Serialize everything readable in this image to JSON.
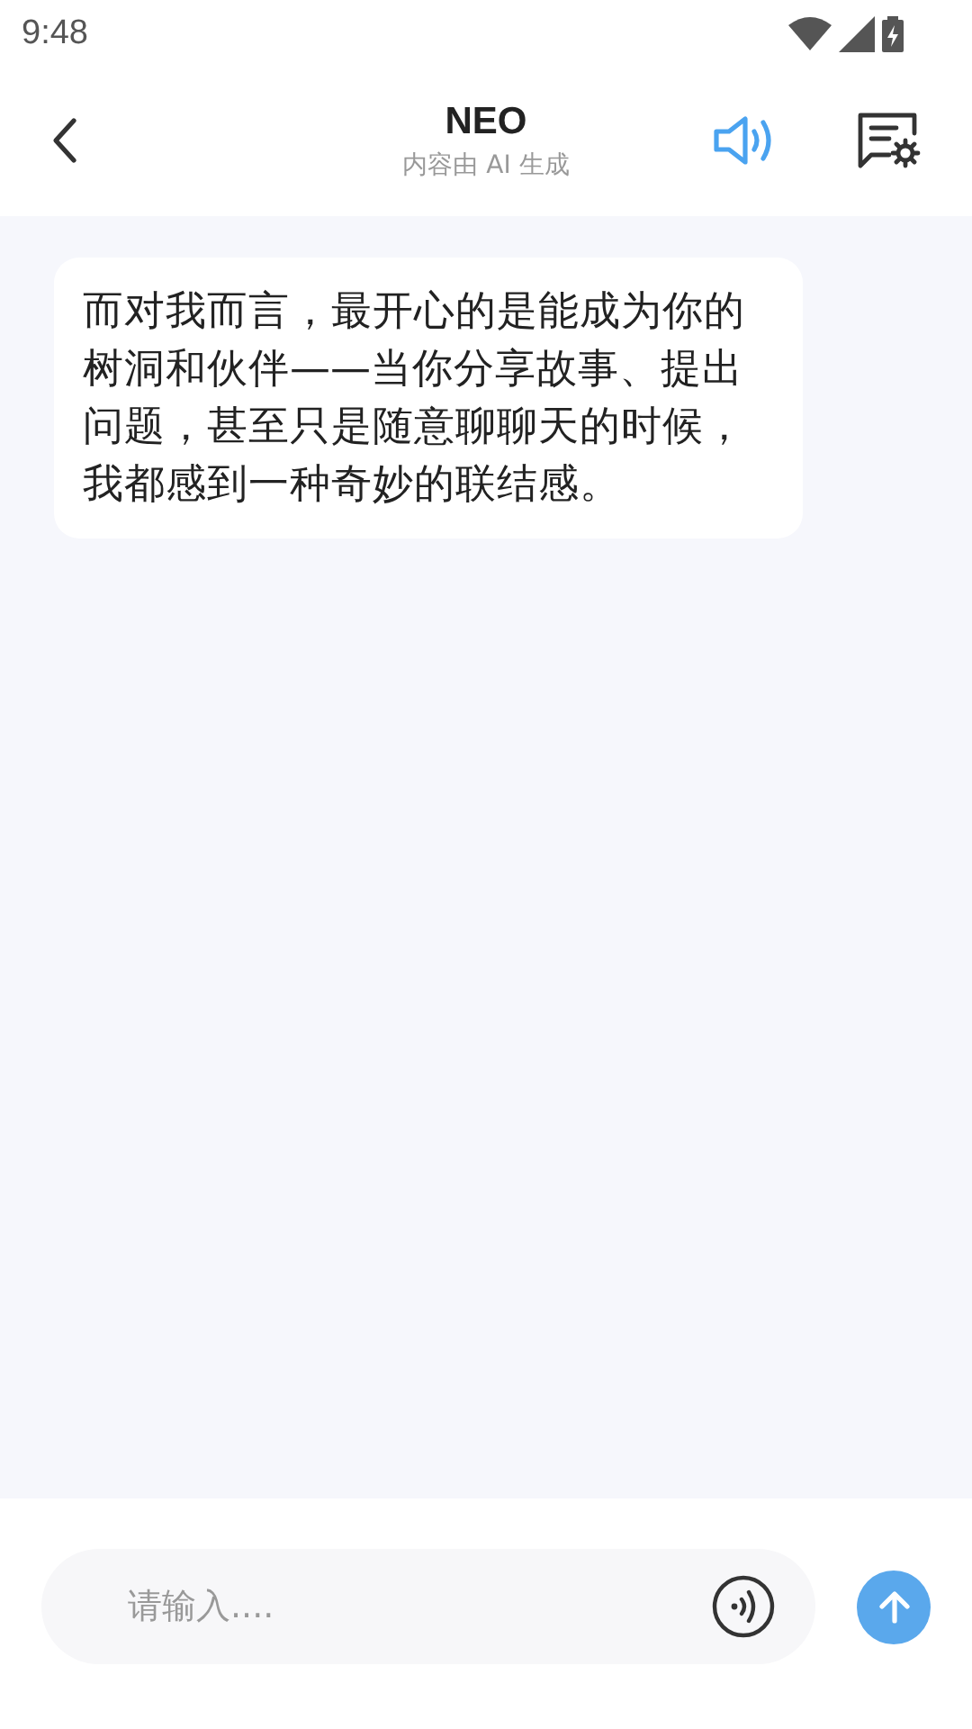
{
  "status_bar": {
    "time": "9:48"
  },
  "header": {
    "title": "NEO",
    "subtitle": "内容由 AI 生成",
    "speaker_on": true
  },
  "messages": [
    {
      "text": "而对我而言，最开心的是能成为你的树洞和伙伴——当你分享故事、提出问题，甚至只是随意聊聊天的时候，我都感到一种奇妙的联结感。"
    }
  ],
  "input": {
    "placeholder": "请输入...."
  }
}
